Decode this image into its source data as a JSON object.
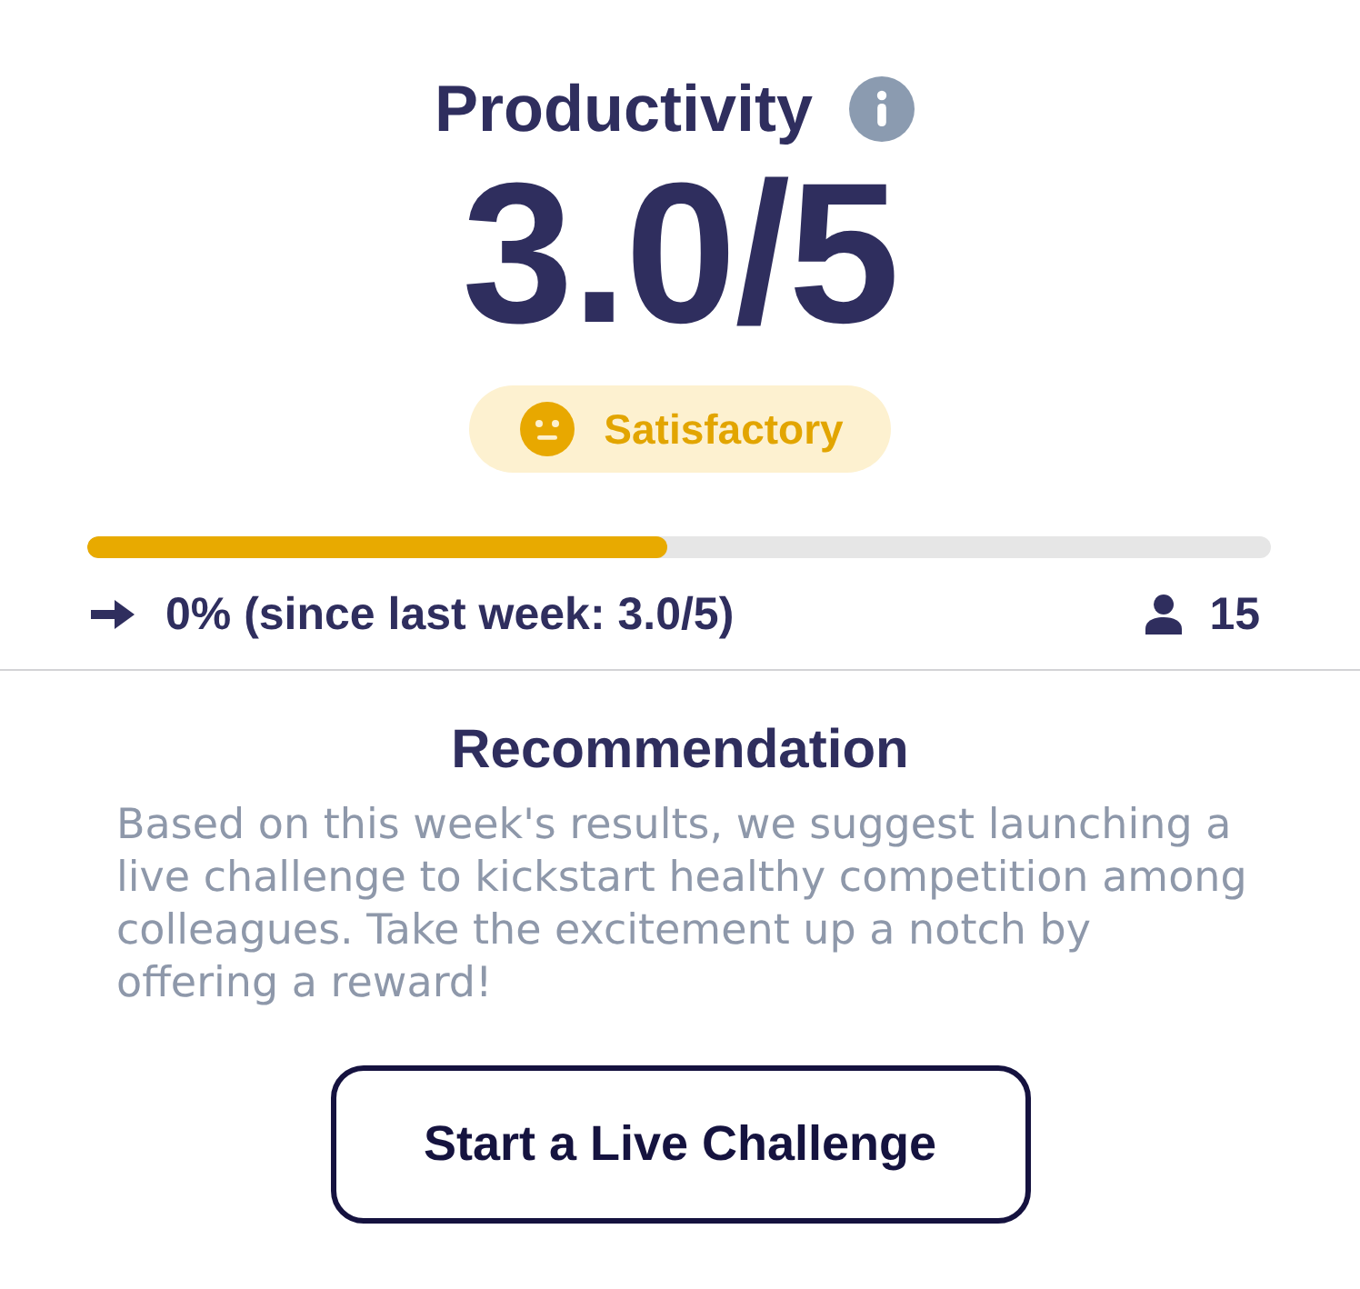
{
  "metric": {
    "title": "Productivity",
    "score": "3.0/5"
  },
  "rating": {
    "label": "Satisfactory",
    "kind": "neutral"
  },
  "progress": {
    "level": 0.49
  },
  "trend": {
    "kind": "flat",
    "text": "0% (since last week: 3.0/5)"
  },
  "participants": {
    "count": "15"
  },
  "recommendation": {
    "title": "Recommendation",
    "body": "Based on this week's results, we suggest launching a live challenge to kickstart healthy competition among colleagues. Take the excitement up a notch by offering a reward!"
  },
  "buttons": [
    {
      "label": "Start a Live Challenge"
    }
  ]
}
